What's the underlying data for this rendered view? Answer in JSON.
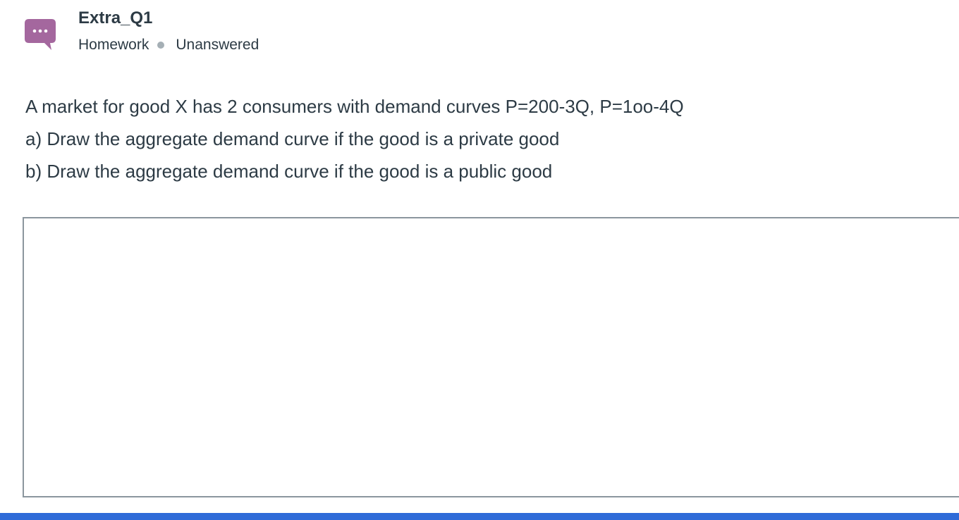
{
  "header": {
    "title": "Extra_Q1",
    "category": "Homework",
    "status": "Unanswered",
    "icon": "discussion-bubble-icon",
    "icon_color": "#a4679e"
  },
  "question": {
    "lines": [
      "A market for good X has 2 consumers with demand curves P=200-3Q, P=1oo-4Q",
      "a) Draw the aggregate demand curve if the good is a private good",
      "b) Draw the aggregate demand curve if the good is a public good"
    ]
  },
  "answer": {
    "value": ""
  },
  "colors": {
    "text": "#2d3b45",
    "bar": "#2f6bd8",
    "border": "#8b969e"
  }
}
